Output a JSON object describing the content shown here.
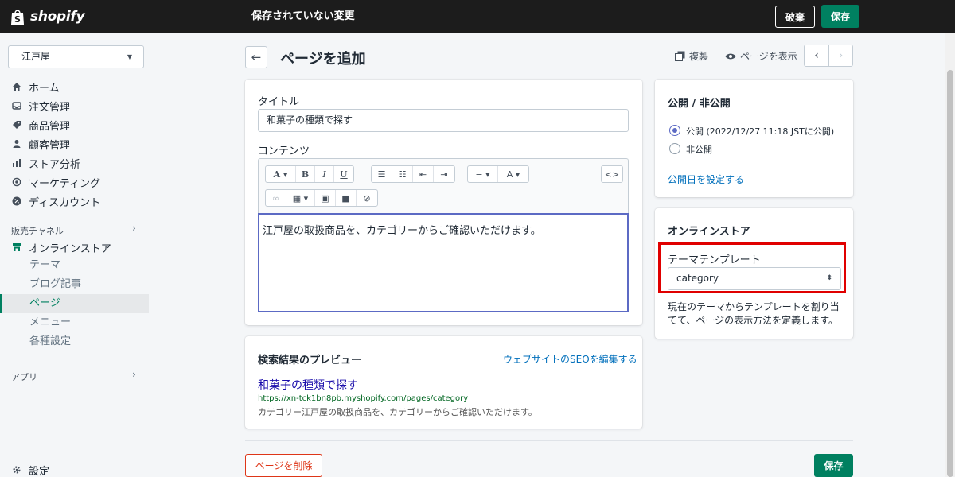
{
  "topbar": {
    "brand": "shopify",
    "status": "保存されていない変更",
    "discard_label": "破棄",
    "save_label": "保存"
  },
  "sidebar": {
    "store_name": "江戸屋",
    "main_items": [
      {
        "label": "ホーム",
        "icon": "home-icon"
      },
      {
        "label": "注文管理",
        "icon": "inbox-icon"
      },
      {
        "label": "商品管理",
        "icon": "tag-icon"
      },
      {
        "label": "顧客管理",
        "icon": "person-icon"
      },
      {
        "label": "ストア分析",
        "icon": "bar-chart-icon"
      },
      {
        "label": "マーケティング",
        "icon": "target-icon"
      },
      {
        "label": "ディスカウント",
        "icon": "discount-icon"
      }
    ],
    "sales_channels_label": "販売チャネル",
    "online_store_label": "オンラインストア",
    "online_store_sub": [
      "テーマ",
      "ブログ記事",
      "ページ",
      "メニュー",
      "各種設定"
    ],
    "active_sub": "ページ",
    "apps_label": "アプリ",
    "settings_label": "設定"
  },
  "header": {
    "title": "ページを追加",
    "duplicate_label": "複製",
    "view_label": "ページを表示"
  },
  "form": {
    "title_label": "タイトル",
    "title_value": "和菓子の種類で探す",
    "content_label": "コンテンツ",
    "content_value": "江戸屋の取扱商品を、カテゴリーからご確認いただけます。"
  },
  "seo": {
    "heading": "検索結果のプレビュー",
    "edit_link": "ウェブサイトのSEOを編集する",
    "preview_title": "和菓子の種類で探す",
    "preview_url": "https://xn-tck1bn8pb.myshopify.com/pages/category",
    "preview_desc": "カテゴリー江戸屋の取扱商品を、カテゴリーからご確認いただけます。"
  },
  "visibility": {
    "heading": "公開 / 非公開",
    "option_public": "公開 (2022/12/27 11:18 JSTに公開)",
    "option_hidden": "非公開",
    "selected": "public",
    "set_date_link": "公開日を設定する"
  },
  "online_store": {
    "heading": "オンラインストア",
    "template_label": "テーマテンプレート",
    "template_value": "category",
    "help_text": "現在のテーマからテンプレートを割り当てて、ページの表示方法を定義します。"
  },
  "footer": {
    "delete_label": "ページを削除",
    "save_label": "保存"
  },
  "colors": {
    "primary": "#008060",
    "link": "#006fbb",
    "danger": "#de3618",
    "highlight": "#e00000",
    "topbar": "#1c1c1c"
  }
}
